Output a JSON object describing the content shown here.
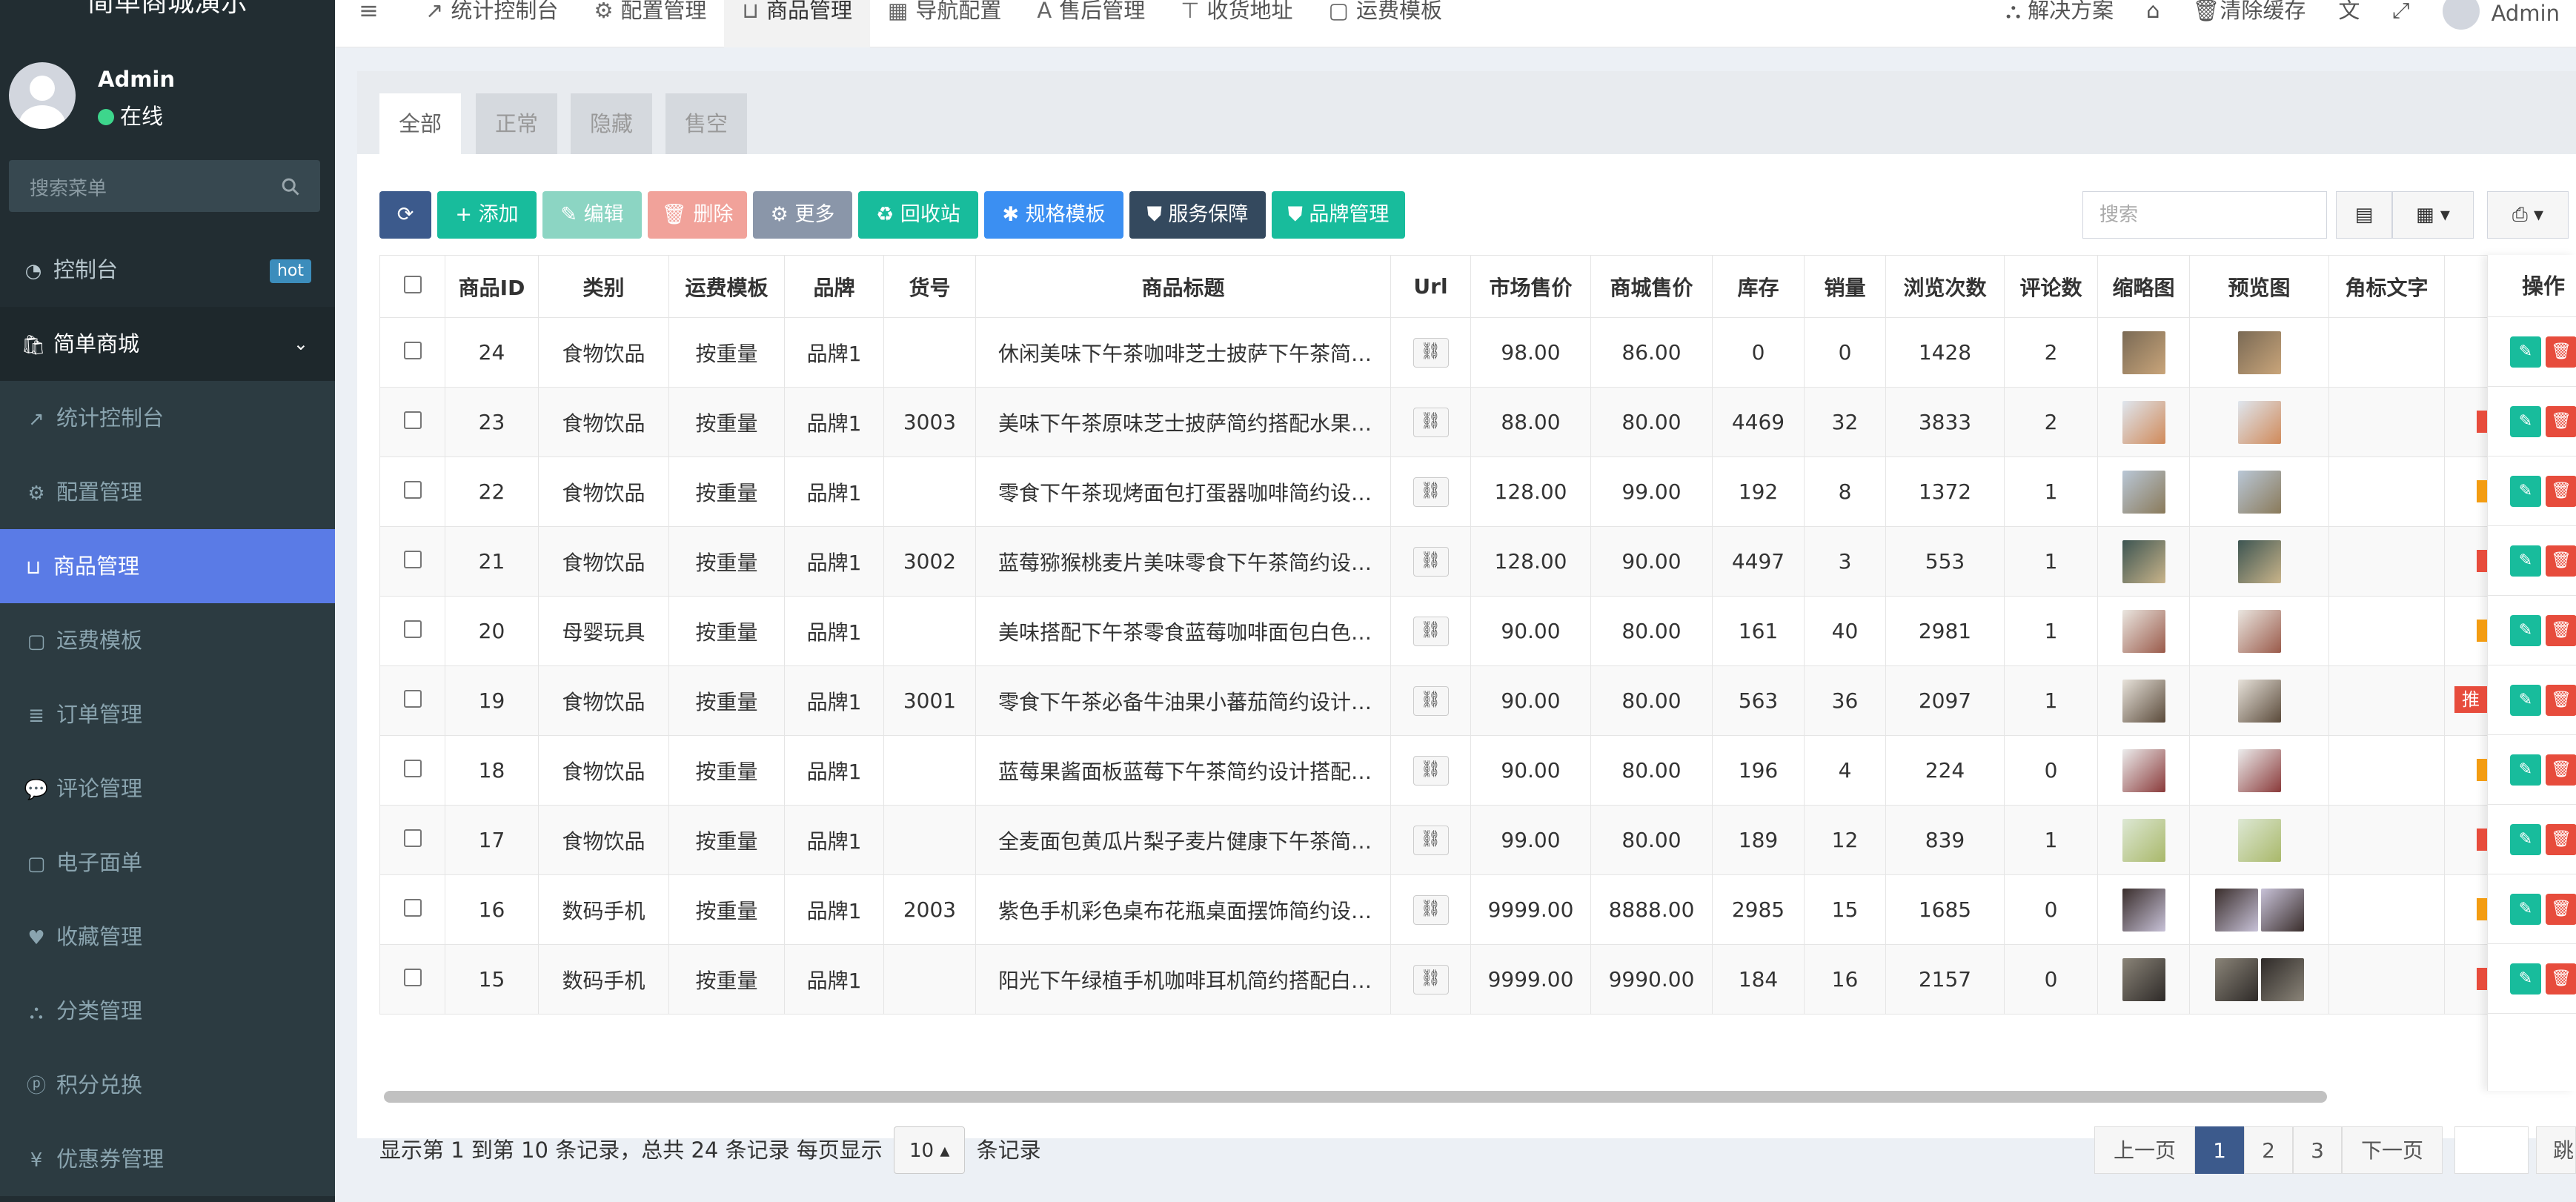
{
  "app": {
    "brand": "简单商城演示",
    "user_name": "Admin",
    "user_status": "在线",
    "search_placeholder": "搜索菜单"
  },
  "sidebar": {
    "items": [
      {
        "label": "控制台",
        "icon": "dashboard-icon",
        "badge": "hot"
      },
      {
        "label": "简单商城",
        "icon": "shop-icon",
        "open": true
      },
      {
        "label": "统计控制台",
        "icon": "line-chart-icon"
      },
      {
        "label": "配置管理",
        "icon": "gear-icon"
      },
      {
        "label": "商品管理",
        "icon": "basket-icon",
        "active": true
      },
      {
        "label": "运费模板",
        "icon": "file-icon"
      },
      {
        "label": "订单管理",
        "icon": "list-icon"
      },
      {
        "label": "评论管理",
        "icon": "comment-icon"
      },
      {
        "label": "电子面单",
        "icon": "file-icon"
      },
      {
        "label": "收藏管理",
        "icon": "heart-icon"
      },
      {
        "label": "分类管理",
        "icon": "sitemap-icon"
      },
      {
        "label": "积分兑换",
        "icon": "pinterest-icon"
      },
      {
        "label": "优惠券管理",
        "icon": "yen-icon"
      }
    ]
  },
  "topbar": {
    "tabs": [
      {
        "label": "统计控制台",
        "icon": "line-chart-icon"
      },
      {
        "label": "配置管理",
        "icon": "gear-icon"
      },
      {
        "label": "商品管理",
        "icon": "basket-icon",
        "active": true
      },
      {
        "label": "导航配置",
        "icon": "grid-icon"
      },
      {
        "label": "售后管理",
        "icon": "font-icon"
      },
      {
        "label": "收货地址",
        "icon": "signpost-icon"
      },
      {
        "label": "运费模板",
        "icon": "file-icon"
      }
    ],
    "right": {
      "solutions": "解决方案",
      "clear_cache": "清除缓存",
      "user": "Admin"
    }
  },
  "filter_tabs": [
    "全部",
    "正常",
    "隐藏",
    "售空"
  ],
  "toolbar": {
    "buttons": [
      {
        "label": "",
        "icon": "refresh-icon",
        "color": "#3c5a8c"
      },
      {
        "label": "添加",
        "icon": "plus-icon",
        "color": "#18bc9c"
      },
      {
        "label": "编辑",
        "icon": "pencil-icon",
        "color": "#8cd5c3"
      },
      {
        "label": "删除",
        "icon": "trash-icon",
        "color": "#f1a29a"
      },
      {
        "label": "更多",
        "icon": "gear-icon",
        "color": "#8a96a9"
      },
      {
        "label": "回收站",
        "icon": "recycle-icon",
        "color": "#18bc9c"
      },
      {
        "label": "规格模板",
        "icon": "asterisk-icon",
        "color": "#3b8ff2"
      },
      {
        "label": "服务保障",
        "icon": "shield-icon",
        "color": "#34495e"
      },
      {
        "label": "品牌管理",
        "icon": "shield-icon",
        "color": "#18bc9c"
      }
    ],
    "search_placeholder": "搜索"
  },
  "table": {
    "columns": [
      "商品ID",
      "类别",
      "运费模板",
      "品牌",
      "货号",
      "商品标题",
      "Url",
      "市场售价",
      "商城售价",
      "库存",
      "销量",
      "浏览次数",
      "评论数",
      "缩略图",
      "预览图",
      "角标文字"
    ],
    "action_header": "操作",
    "rows": [
      {
        "id": "24",
        "category": "食物饮品",
        "shipping": "按重量",
        "brand": "品牌1",
        "sku": "",
        "title": "休闲美味下午茶咖啡芝士披萨下午茶简约设计搭配",
        "market_price": "98.00",
        "price": "86.00",
        "stock": "0",
        "sales": "0",
        "views": "1428",
        "comments": "2",
        "previews": 1,
        "thumb_colors": [
          "#7a6a55",
          "#c9a57a"
        ]
      },
      {
        "id": "23",
        "category": "食物饮品",
        "shipping": "按重量",
        "brand": "品牌1",
        "sku": "3003",
        "title": "美味下午茶原味芝士披萨简约搭配水果茶点",
        "market_price": "88.00",
        "price": "80.00",
        "stock": "4469",
        "sales": "32",
        "views": "3833",
        "comments": "2",
        "previews": 1,
        "thumb_colors": [
          "#dfe6ee",
          "#d08a5a"
        ]
      },
      {
        "id": "22",
        "category": "食物饮品",
        "shipping": "按重量",
        "brand": "品牌1",
        "sku": "",
        "title": "零食下午茶现烤面包打蛋器咖啡简约设计搭配",
        "market_price": "128.00",
        "price": "99.00",
        "stock": "192",
        "sales": "8",
        "views": "1372",
        "comments": "1",
        "previews": 1,
        "thumb_colors": [
          "#b9c7d6",
          "#8a7a5a"
        ]
      },
      {
        "id": "21",
        "category": "食物饮品",
        "shipping": "按重量",
        "brand": "品牌1",
        "sku": "3002",
        "title": "蓝莓猕猴桃麦片美味零食下午茶简约设计搭配",
        "market_price": "128.00",
        "price": "90.00",
        "stock": "4497",
        "sales": "3",
        "views": "553",
        "comments": "1",
        "previews": 1,
        "thumb_colors": [
          "#3d5552",
          "#c9b48a"
        ]
      },
      {
        "id": "20",
        "category": "母婴玩具",
        "shipping": "按重量",
        "brand": "品牌1",
        "sku": "",
        "title": "美味搭配下午茶零食蓝莓咖啡面包白色餐具",
        "market_price": "90.00",
        "price": "80.00",
        "stock": "161",
        "sales": "40",
        "views": "2981",
        "comments": "1",
        "previews": 1,
        "thumb_colors": [
          "#eae6e0",
          "#9a5a4a"
        ]
      },
      {
        "id": "19",
        "category": "食物饮品",
        "shipping": "按重量",
        "brand": "品牌1",
        "sku": "3001",
        "title": "零食下午茶必备牛油果小蕃茄简约设计搭配",
        "market_price": "90.00",
        "price": "80.00",
        "stock": "563",
        "sales": "36",
        "views": "2097",
        "comments": "1",
        "previews": 1,
        "thumb_colors": [
          "#e7e2da",
          "#5a4a3a"
        ],
        "tag": "推荐"
      },
      {
        "id": "18",
        "category": "食物饮品",
        "shipping": "按重量",
        "brand": "品牌1",
        "sku": "",
        "title": "蓝莓果酱面板蓝莓下午茶简约设计搭配白色",
        "market_price": "90.00",
        "price": "80.00",
        "stock": "196",
        "sales": "4",
        "views": "224",
        "comments": "0",
        "previews": 1,
        "thumb_colors": [
          "#ececec",
          "#8a3a3a"
        ]
      },
      {
        "id": "17",
        "category": "食物饮品",
        "shipping": "按重量",
        "brand": "品牌1",
        "sku": "",
        "title": "全麦面包黄瓜片梨子麦片健康下午茶简约搭配",
        "market_price": "99.00",
        "price": "80.00",
        "stock": "189",
        "sales": "12",
        "views": "839",
        "comments": "1",
        "previews": 1,
        "thumb_colors": [
          "#dde8d4",
          "#a9b86a"
        ]
      },
      {
        "id": "16",
        "category": "数码手机",
        "shipping": "按重量",
        "brand": "品牌1",
        "sku": "2003",
        "title": "紫色手机彩色桌布花瓶桌面摆饰简约设计搭配",
        "market_price": "9999.00",
        "price": "8888.00",
        "stock": "2985",
        "sales": "15",
        "views": "1685",
        "comments": "0",
        "previews": 2,
        "thumb_colors": [
          "#3a2e2c",
          "#c8c2d8"
        ]
      },
      {
        "id": "15",
        "category": "数码手机",
        "shipping": "按重量",
        "brand": "品牌1",
        "sku": "",
        "title": "阳光下午绿植手机咖啡耳机简约搭配白色桌面",
        "market_price": "9999.00",
        "price": "9990.00",
        "stock": "184",
        "sales": "16",
        "views": "2157",
        "comments": "0",
        "previews": 2,
        "thumb_colors": [
          "#8a8478",
          "#2e2a28"
        ]
      }
    ]
  },
  "pagination": {
    "summary_prefix": "显示第 1 到第 10 条记录，总共 24 条记录 每页显示",
    "page_size": "10",
    "summary_suffix": "条记录",
    "prev": "上一页",
    "pages": [
      "1",
      "2",
      "3"
    ],
    "next": "下一页",
    "jump": "跳转"
  }
}
